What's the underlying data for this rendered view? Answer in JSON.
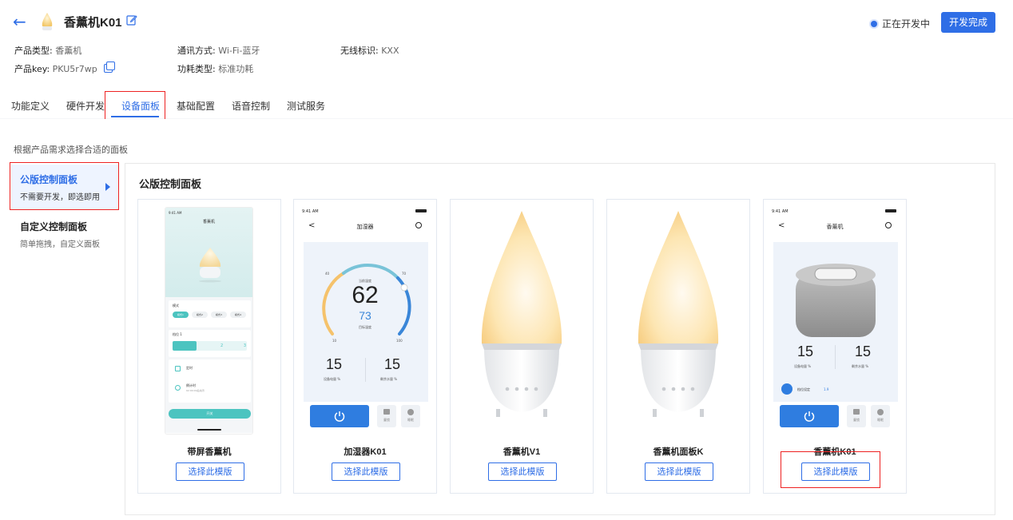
{
  "header": {
    "title": "香薰机K01",
    "status": "正在开发中",
    "done_button": "开发完成",
    "meta": [
      {
        "k": "产品类型",
        "v": "香薰机"
      },
      {
        "k": "通讯方式",
        "v": "Wi-Fi-蓝牙"
      },
      {
        "k": "无线标识",
        "v": "KXX"
      },
      {
        "k": "产品key",
        "v": "PKU5r7wp"
      },
      {
        "k": "功耗类型",
        "v": "标准功耗"
      }
    ]
  },
  "tabs": [
    "功能定义",
    "硬件开发",
    "设备面板",
    "基础配置",
    "语音控制",
    "测试服务"
  ],
  "active_tab": "设备面板",
  "hint": "根据产品需求选择合适的面板",
  "sidebar": [
    {
      "title": "公版控制面板",
      "subtitle": "不需要开发，即选即用",
      "active": true
    },
    {
      "title": "自定义控制面板",
      "subtitle": "简单拖拽，自定义面板",
      "active": false
    }
  ],
  "panel_title": "公版控制面板",
  "pick_label": "选择此模版",
  "cards": [
    {
      "name": "带屏香薰机"
    },
    {
      "name": "加湿器K01"
    },
    {
      "name": "香薰机V1"
    },
    {
      "name": "香薰机面板K"
    },
    {
      "name": "香薰机K01"
    }
  ],
  "mock": {
    "time": "9:41 AM",
    "screen1": {
      "title": "香薰机",
      "mode_label": "模式",
      "modes": [
        "模式1",
        "模式2",
        "模式3",
        "模式4"
      ],
      "level_label": "档位 1",
      "level_mid": "2",
      "level_end": "3",
      "timer": "定时",
      "countdown": "倒计时",
      "countdown_sub": "02:00:00后关闭",
      "power": "开关"
    },
    "screen2": {
      "title": "加湿器",
      "current_label": "当前湿度",
      "current": "62",
      "target": "73",
      "target_label": "目标湿度",
      "tick40": "40",
      "tick70": "70",
      "tick10": "10",
      "tick100": "100",
      "left_num": "15",
      "left_lbl": "设备电量 %",
      "right_num": "15",
      "right_lbl": "剩余水量 %",
      "btn_b": "童锁",
      "btn_c": "睡眠"
    },
    "screen5": {
      "title": "香薰机",
      "left_num": "15",
      "left_lbl": "设备电量 %",
      "right_num": "15",
      "right_lbl": "剩余水量 %",
      "gear_label": "档位设定",
      "gear_val": "1.9",
      "btn_b": "童锁",
      "btn_c": "睡眠"
    }
  },
  "colors": {
    "accent": "#2f6ee6",
    "highlight": "#e22222",
    "teal": "#4cc4c0"
  }
}
